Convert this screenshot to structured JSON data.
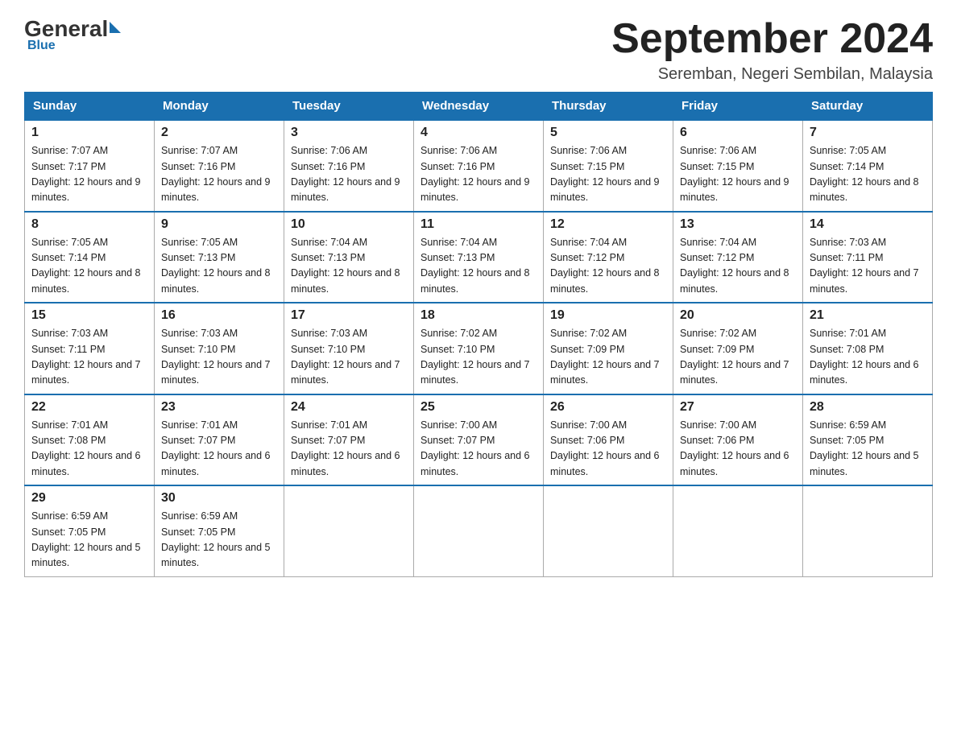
{
  "header": {
    "logo": {
      "general": "General",
      "blue": "Blue"
    },
    "title": "September 2024",
    "subtitle": "Seremban, Negeri Sembilan, Malaysia"
  },
  "columns": [
    "Sunday",
    "Monday",
    "Tuesday",
    "Wednesday",
    "Thursday",
    "Friday",
    "Saturday"
  ],
  "weeks": [
    [
      {
        "day": "1",
        "sunrise": "Sunrise: 7:07 AM",
        "sunset": "Sunset: 7:17 PM",
        "daylight": "Daylight: 12 hours and 9 minutes."
      },
      {
        "day": "2",
        "sunrise": "Sunrise: 7:07 AM",
        "sunset": "Sunset: 7:16 PM",
        "daylight": "Daylight: 12 hours and 9 minutes."
      },
      {
        "day": "3",
        "sunrise": "Sunrise: 7:06 AM",
        "sunset": "Sunset: 7:16 PM",
        "daylight": "Daylight: 12 hours and 9 minutes."
      },
      {
        "day": "4",
        "sunrise": "Sunrise: 7:06 AM",
        "sunset": "Sunset: 7:16 PM",
        "daylight": "Daylight: 12 hours and 9 minutes."
      },
      {
        "day": "5",
        "sunrise": "Sunrise: 7:06 AM",
        "sunset": "Sunset: 7:15 PM",
        "daylight": "Daylight: 12 hours and 9 minutes."
      },
      {
        "day": "6",
        "sunrise": "Sunrise: 7:06 AM",
        "sunset": "Sunset: 7:15 PM",
        "daylight": "Daylight: 12 hours and 9 minutes."
      },
      {
        "day": "7",
        "sunrise": "Sunrise: 7:05 AM",
        "sunset": "Sunset: 7:14 PM",
        "daylight": "Daylight: 12 hours and 8 minutes."
      }
    ],
    [
      {
        "day": "8",
        "sunrise": "Sunrise: 7:05 AM",
        "sunset": "Sunset: 7:14 PM",
        "daylight": "Daylight: 12 hours and 8 minutes."
      },
      {
        "day": "9",
        "sunrise": "Sunrise: 7:05 AM",
        "sunset": "Sunset: 7:13 PM",
        "daylight": "Daylight: 12 hours and 8 minutes."
      },
      {
        "day": "10",
        "sunrise": "Sunrise: 7:04 AM",
        "sunset": "Sunset: 7:13 PM",
        "daylight": "Daylight: 12 hours and 8 minutes."
      },
      {
        "day": "11",
        "sunrise": "Sunrise: 7:04 AM",
        "sunset": "Sunset: 7:13 PM",
        "daylight": "Daylight: 12 hours and 8 minutes."
      },
      {
        "day": "12",
        "sunrise": "Sunrise: 7:04 AM",
        "sunset": "Sunset: 7:12 PM",
        "daylight": "Daylight: 12 hours and 8 minutes."
      },
      {
        "day": "13",
        "sunrise": "Sunrise: 7:04 AM",
        "sunset": "Sunset: 7:12 PM",
        "daylight": "Daylight: 12 hours and 8 minutes."
      },
      {
        "day": "14",
        "sunrise": "Sunrise: 7:03 AM",
        "sunset": "Sunset: 7:11 PM",
        "daylight": "Daylight: 12 hours and 7 minutes."
      }
    ],
    [
      {
        "day": "15",
        "sunrise": "Sunrise: 7:03 AM",
        "sunset": "Sunset: 7:11 PM",
        "daylight": "Daylight: 12 hours and 7 minutes."
      },
      {
        "day": "16",
        "sunrise": "Sunrise: 7:03 AM",
        "sunset": "Sunset: 7:10 PM",
        "daylight": "Daylight: 12 hours and 7 minutes."
      },
      {
        "day": "17",
        "sunrise": "Sunrise: 7:03 AM",
        "sunset": "Sunset: 7:10 PM",
        "daylight": "Daylight: 12 hours and 7 minutes."
      },
      {
        "day": "18",
        "sunrise": "Sunrise: 7:02 AM",
        "sunset": "Sunset: 7:10 PM",
        "daylight": "Daylight: 12 hours and 7 minutes."
      },
      {
        "day": "19",
        "sunrise": "Sunrise: 7:02 AM",
        "sunset": "Sunset: 7:09 PM",
        "daylight": "Daylight: 12 hours and 7 minutes."
      },
      {
        "day": "20",
        "sunrise": "Sunrise: 7:02 AM",
        "sunset": "Sunset: 7:09 PM",
        "daylight": "Daylight: 12 hours and 7 minutes."
      },
      {
        "day": "21",
        "sunrise": "Sunrise: 7:01 AM",
        "sunset": "Sunset: 7:08 PM",
        "daylight": "Daylight: 12 hours and 6 minutes."
      }
    ],
    [
      {
        "day": "22",
        "sunrise": "Sunrise: 7:01 AM",
        "sunset": "Sunset: 7:08 PM",
        "daylight": "Daylight: 12 hours and 6 minutes."
      },
      {
        "day": "23",
        "sunrise": "Sunrise: 7:01 AM",
        "sunset": "Sunset: 7:07 PM",
        "daylight": "Daylight: 12 hours and 6 minutes."
      },
      {
        "day": "24",
        "sunrise": "Sunrise: 7:01 AM",
        "sunset": "Sunset: 7:07 PM",
        "daylight": "Daylight: 12 hours and 6 minutes."
      },
      {
        "day": "25",
        "sunrise": "Sunrise: 7:00 AM",
        "sunset": "Sunset: 7:07 PM",
        "daylight": "Daylight: 12 hours and 6 minutes."
      },
      {
        "day": "26",
        "sunrise": "Sunrise: 7:00 AM",
        "sunset": "Sunset: 7:06 PM",
        "daylight": "Daylight: 12 hours and 6 minutes."
      },
      {
        "day": "27",
        "sunrise": "Sunrise: 7:00 AM",
        "sunset": "Sunset: 7:06 PM",
        "daylight": "Daylight: 12 hours and 6 minutes."
      },
      {
        "day": "28",
        "sunrise": "Sunrise: 6:59 AM",
        "sunset": "Sunset: 7:05 PM",
        "daylight": "Daylight: 12 hours and 5 minutes."
      }
    ],
    [
      {
        "day": "29",
        "sunrise": "Sunrise: 6:59 AM",
        "sunset": "Sunset: 7:05 PM",
        "daylight": "Daylight: 12 hours and 5 minutes."
      },
      {
        "day": "30",
        "sunrise": "Sunrise: 6:59 AM",
        "sunset": "Sunset: 7:05 PM",
        "daylight": "Daylight: 12 hours and 5 minutes."
      },
      null,
      null,
      null,
      null,
      null
    ]
  ]
}
